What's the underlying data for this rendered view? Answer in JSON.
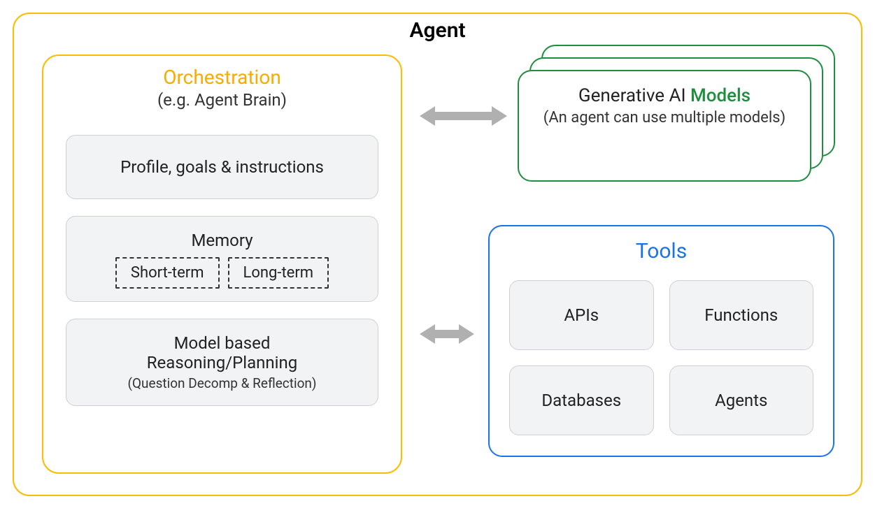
{
  "agent": {
    "title": "Agent"
  },
  "orchestration": {
    "title": "Orchestration",
    "subtitle": "(e.g. Agent Brain)",
    "profile": "Profile, goals & instructions",
    "memory": {
      "title": "Memory",
      "short": "Short-term",
      "long": "Long-term"
    },
    "reasoning": {
      "title1": "Model based",
      "title2": "Reasoning/Planning",
      "subtitle": "(Question Decomp & Reflection)"
    }
  },
  "models": {
    "title_prefix": "Generative AI ",
    "title_highlight": "Models",
    "subtitle": "(An agent can use multiple models)"
  },
  "tools": {
    "title": "Tools",
    "items": [
      "APIs",
      "Functions",
      "Databases",
      "Agents"
    ]
  }
}
